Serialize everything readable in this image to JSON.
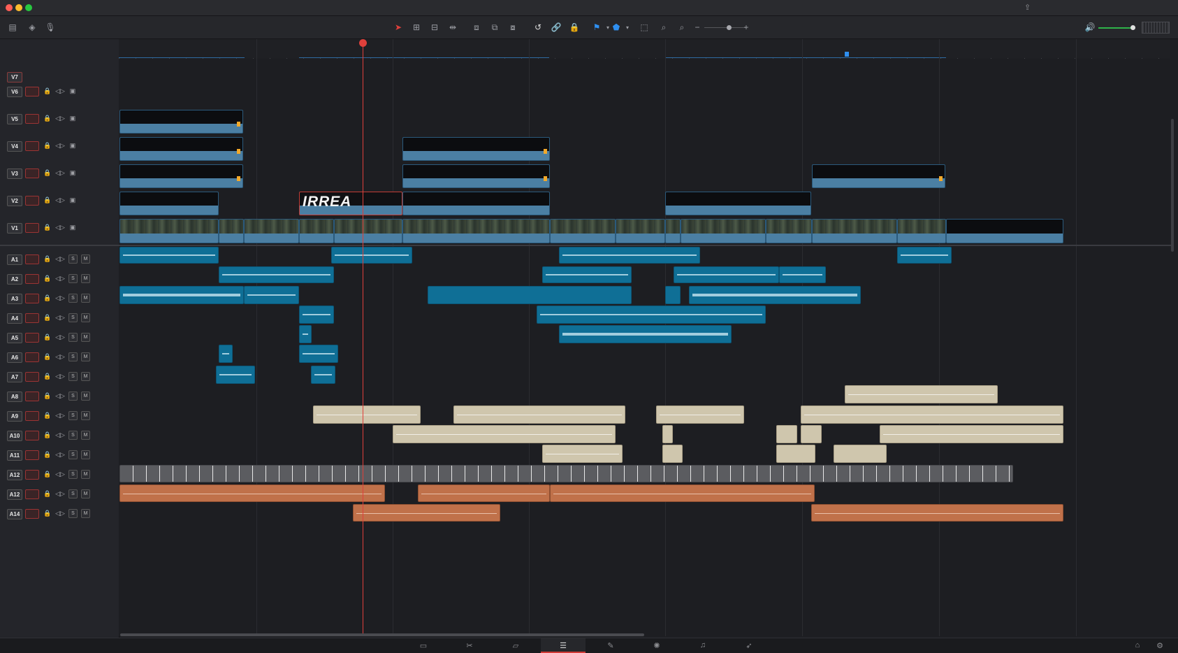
{
  "colors": {
    "playhead": "#e0403b",
    "video_clip": "#4b7fa3",
    "audio_clip": "#0f6f96",
    "music_clip": "#cfc6ad",
    "sfx_clip": "#c0714a",
    "active_page": "#d23a36"
  },
  "window": {
    "traffic_lights": [
      "close",
      "minimize",
      "zoom"
    ]
  },
  "toolbar": {
    "left_icons": [
      "track-height-icon",
      "layers-icon",
      "microphone-icon"
    ],
    "center_icons": [
      "selection-arrow-icon",
      "trim-icon",
      "blade-icon",
      "dynamic-trim-icon",
      "insert-icon",
      "overwrite-icon",
      "replace-icon",
      "snapping-icon",
      "linked-selection-icon",
      "position-lock-icon",
      "flag-icon",
      "marker-icon",
      "zoom-full-icon",
      "zoom-detail-icon",
      "zoom-custom-icon"
    ],
    "zoom_minus": "−",
    "zoom_plus": "+",
    "right_icons": [
      "speaker-icon",
      "meter-icon"
    ]
  },
  "tracks": {
    "video": [
      "V7",
      "V6",
      "V5",
      "V4",
      "V3",
      "V2",
      "V1"
    ],
    "audio": [
      "A1",
      "A2",
      "A3",
      "A4",
      "A5",
      "A6",
      "A7",
      "A8",
      "A9",
      "A10",
      "A11",
      "A12",
      "A12",
      "A14"
    ],
    "solo": "S",
    "mute": "M"
  },
  "title_clip": {
    "text": "IRREA"
  },
  "pages": [
    "media-page-icon",
    "cut-page-icon",
    "edit-page-icon",
    "fusion-page-icon",
    "color-page-icon",
    "fairlight-page-icon",
    "deliver-page-icon"
  ],
  "active_page_index": 3,
  "bottom_right_icons": [
    "home-icon",
    "settings-icon"
  ]
}
